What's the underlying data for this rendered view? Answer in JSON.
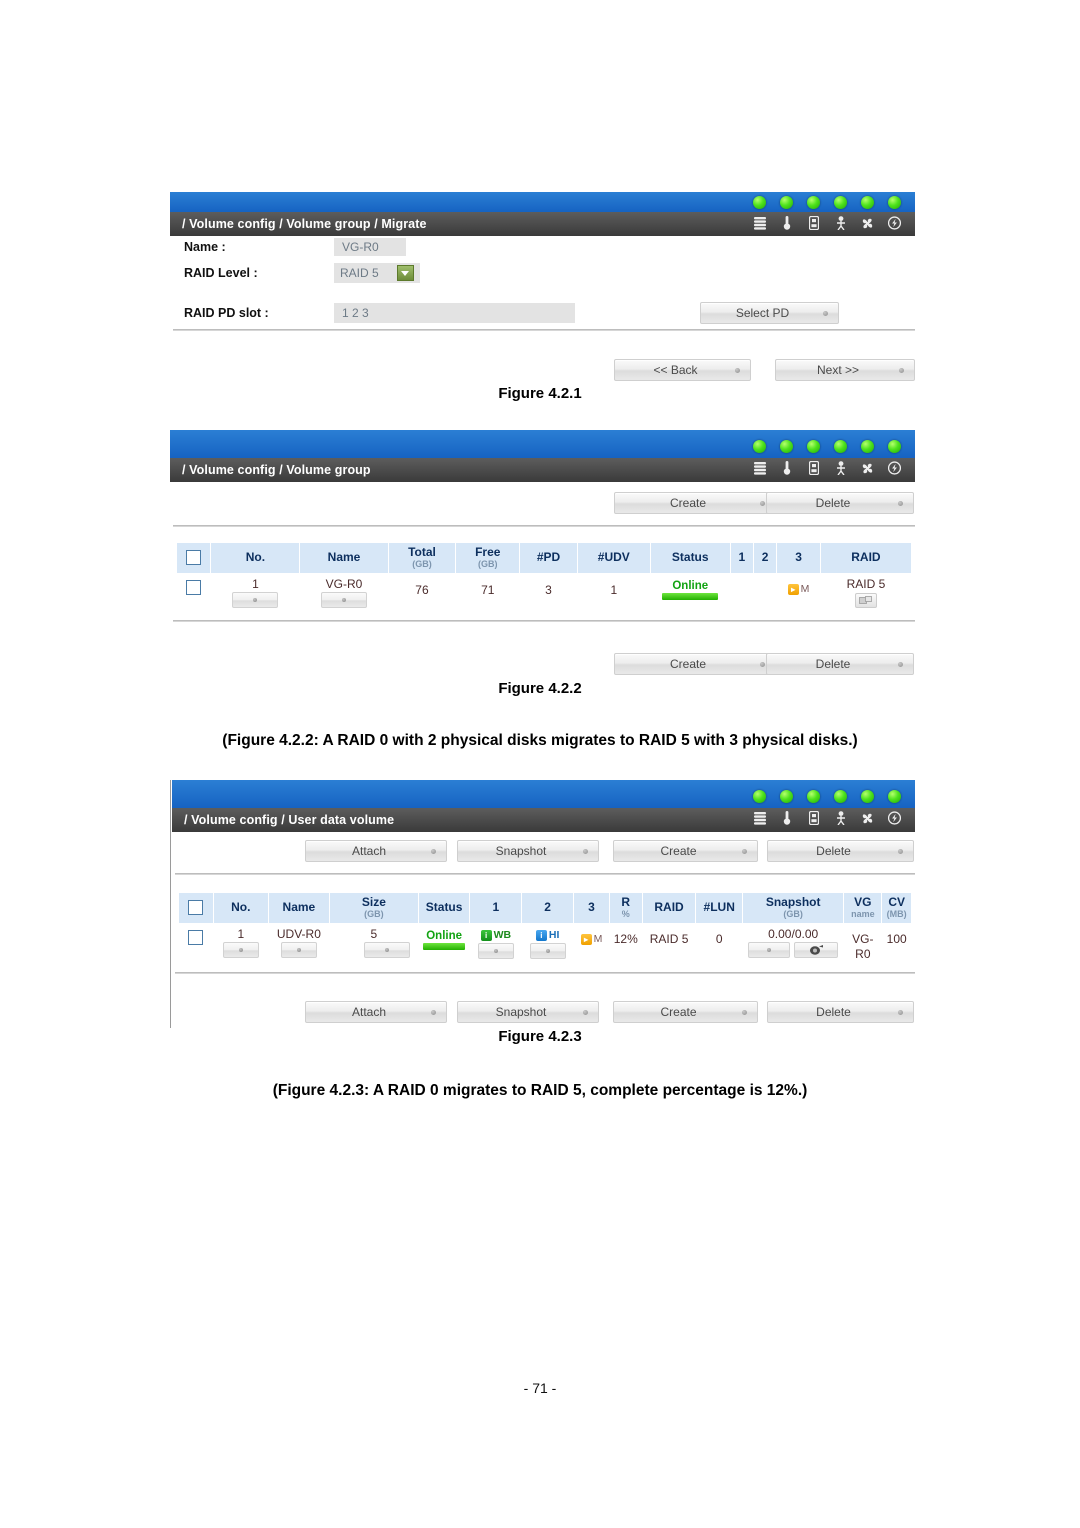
{
  "page": {
    "number": "- 71 -"
  },
  "icons": {
    "leds": [
      "led-1",
      "led-2",
      "led-3",
      "led-4",
      "led-5",
      "led-6"
    ],
    "system": [
      "raid-array-icon",
      "thermometer-icon",
      "battery-icon",
      "voltage-icon",
      "fan-icon",
      "power-icon"
    ]
  },
  "figure_1": {
    "label": "Figure 4.2.1",
    "breadcrumb": "/ Volume config / Volume group / Migrate",
    "form": {
      "name_label": "Name :",
      "name_value": "VG-R0",
      "raid_level_label": "RAID Level :",
      "raid_level_value": "RAID 5",
      "pd_slot_label": "RAID PD slot :",
      "pd_slot_value": "1 2 3"
    },
    "buttons": {
      "select_pd": "Select PD",
      "back": "<< Back",
      "next": "Next >>"
    }
  },
  "figure_2": {
    "label": "Figure 4.2.2",
    "caption": "(Figure 4.2.2: A RAID 0 with 2 physical disks migrates to RAID 5 with 3 physical disks.)",
    "breadcrumb": "/ Volume config / Volume group",
    "buttons": {
      "create": "Create",
      "delete": "Delete"
    },
    "table": {
      "columns": [
        {
          "label": "",
          "unit": ""
        },
        {
          "label": "No.",
          "unit": ""
        },
        {
          "label": "Name",
          "unit": ""
        },
        {
          "label": "Total",
          "unit": "(GB)"
        },
        {
          "label": "Free",
          "unit": "(GB)"
        },
        {
          "label": "#PD",
          "unit": ""
        },
        {
          "label": "#UDV",
          "unit": ""
        },
        {
          "label": "Status",
          "unit": ""
        },
        {
          "label": "1",
          "unit": ""
        },
        {
          "label": "2",
          "unit": ""
        },
        {
          "label": "3",
          "unit": ""
        },
        {
          "label": "RAID",
          "unit": ""
        }
      ],
      "row": {
        "no": "1",
        "name": "VG-R0",
        "total": "76",
        "free": "71",
        "pd": "3",
        "udv": "1",
        "status": "Online",
        "col1": "",
        "col2": "",
        "col3_badge": "M",
        "raid": "RAID 5"
      }
    }
  },
  "figure_3": {
    "label": "Figure 4.2.3",
    "caption": "(Figure 4.2.3: A RAID 0 migrates to RAID 5, complete percentage is 12%.)",
    "breadcrumb": "/ Volume config / User data volume",
    "buttons": {
      "attach": "Attach",
      "snapshot": "Snapshot",
      "create": "Create",
      "delete": "Delete"
    },
    "table": {
      "columns": [
        {
          "label": "",
          "unit": ""
        },
        {
          "label": "No.",
          "unit": ""
        },
        {
          "label": "Name",
          "unit": ""
        },
        {
          "label": "Size",
          "unit": "(GB)"
        },
        {
          "label": "Status",
          "unit": ""
        },
        {
          "label": "1",
          "unit": ""
        },
        {
          "label": "2",
          "unit": ""
        },
        {
          "label": "3",
          "unit": ""
        },
        {
          "label": "R",
          "unit": "%"
        },
        {
          "label": "RAID",
          "unit": ""
        },
        {
          "label": "#LUN",
          "unit": ""
        },
        {
          "label": "Snapshot",
          "unit": "(GB)"
        },
        {
          "label": "VG",
          "unit": "name"
        },
        {
          "label": "CV",
          "unit": "(MB)"
        }
      ],
      "row": {
        "no": "1",
        "name": "UDV-R0",
        "size": "5",
        "status": "Online",
        "cache_mode": "WB",
        "priority": "HI",
        "migrate_badge": "M",
        "r_percent": "12%",
        "raid": "RAID 5",
        "lun": "0",
        "snapshot": "0.00/0.00",
        "vg_name": "VG-R0",
        "cv": "100"
      }
    }
  }
}
